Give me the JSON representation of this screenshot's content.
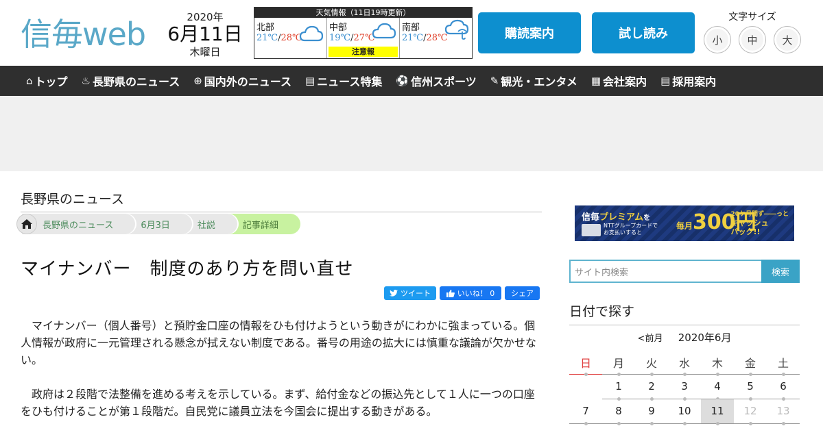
{
  "header": {
    "logo": "信毎web",
    "date_year": "2020年",
    "date_md": "6月11日",
    "date_weekday": "木曜日",
    "weather": {
      "title": "天気情報（11日19時更新）",
      "regions": [
        {
          "name": "北部",
          "min": "21℃",
          "max": "28℃",
          "icon": "cloud-icon",
          "alert": ""
        },
        {
          "name": "中部",
          "min": "19℃",
          "max": "27℃",
          "icon": "cloud-icon",
          "alert": "注意報"
        },
        {
          "name": "南部",
          "min": "21℃",
          "max": "28℃",
          "icon": "cloud-rain-icon",
          "alert": ""
        }
      ]
    },
    "subscribe_label": "購読案内",
    "trial_label": "試し読み",
    "fontsize_label": "文字サイズ",
    "fontsize_small": "小",
    "fontsize_medium": "中",
    "fontsize_large": "大"
  },
  "nav": [
    {
      "icon": "home-icon",
      "glyph": "⌂",
      "label": "トップ"
    },
    {
      "icon": "flame-icon",
      "glyph": "♨",
      "label": "長野県のニュース"
    },
    {
      "icon": "globe-icon",
      "glyph": "⊕",
      "label": "国内外のニュース"
    },
    {
      "icon": "document-icon",
      "glyph": "▤",
      "label": "ニュース特集"
    },
    {
      "icon": "sports-icon",
      "glyph": "⚽",
      "label": "信州スポーツ"
    },
    {
      "icon": "ticket-icon",
      "glyph": "✎",
      "label": "観光・エンタメ"
    },
    {
      "icon": "building-icon",
      "glyph": "▦",
      "label": "会社案内"
    },
    {
      "icon": "list-icon",
      "glyph": "▤",
      "label": "採用案内"
    }
  ],
  "main": {
    "section_title": "長野県のニュース",
    "breadcrumbs": [
      "長野県のニュース",
      "6月3日",
      "社説",
      "記事詳細"
    ],
    "article_title": "マイナンバー　制度のあり方を問い直せ",
    "share": {
      "tweet": "ツイート",
      "like": "いいね！ 0",
      "share": "シェア"
    },
    "paragraphs": [
      "マイナンバー（個人番号）と預貯金口座の情報をひも付けようという動きがにわかに強まっている。個人情報が政府に一元管理される懸念が拭えない制度である。番号の用途の拡大には慎重な議論が欠かせない。",
      "政府は２段階で法整備を進める考えを示している。まず、給付金などの振込先として１人に一つの口座をひも付けることが第１段階だ。自民党に議員立法を今国会に提出する動きがある。"
    ]
  },
  "sidebar": {
    "banner": {
      "line1_a": "信毎",
      "line1_b": "プレミアム",
      "line1_c": "を",
      "small1": "NTTグループカードで",
      "small2": "お支払いすると",
      "big_prefix": "毎月",
      "big": "300円",
      "right1": "20ケ月間ず――っと",
      "right2": "キャッシュ",
      "right3": "バック!!"
    },
    "search_placeholder": "サイト内検索",
    "search_button": "検索",
    "date_title": "日付で探す",
    "calendar": {
      "prev": "<前月",
      "month": "2020年6月",
      "weekdays": [
        "日",
        "月",
        "火",
        "水",
        "木",
        "金",
        "土"
      ],
      "week1": [
        "",
        "1",
        "2",
        "3",
        "4",
        "5",
        "6"
      ],
      "week2": [
        "7",
        "8",
        "9",
        "10",
        "11",
        "12",
        "13"
      ]
    }
  }
}
